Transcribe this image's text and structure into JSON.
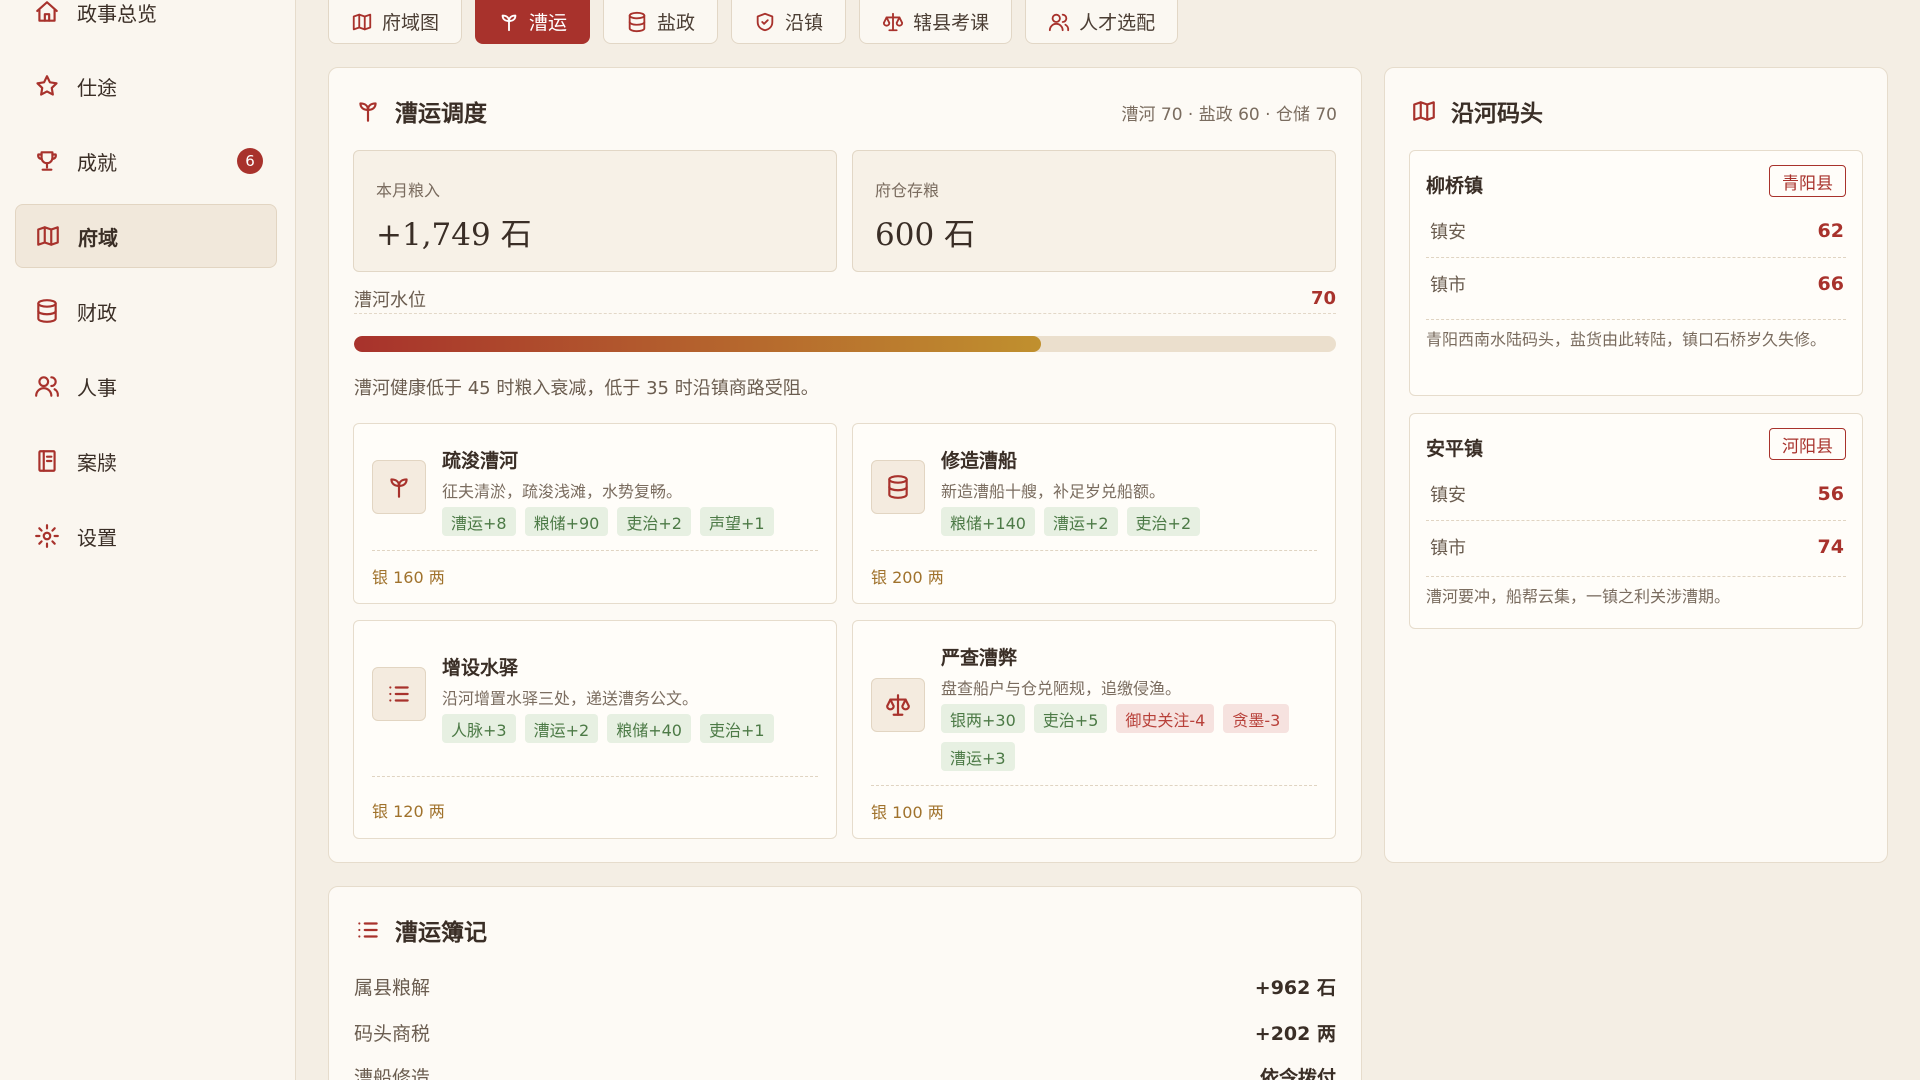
{
  "sidebar": {
    "items": [
      {
        "label": "政事总览",
        "icon": "home-icon"
      },
      {
        "label": "仕途",
        "icon": "star-icon"
      },
      {
        "label": "成就",
        "icon": "trophy-icon",
        "badge": "6"
      },
      {
        "label": "府域",
        "icon": "map-icon",
        "active": true
      },
      {
        "label": "财政",
        "icon": "database-icon"
      },
      {
        "label": "人事",
        "icon": "users-icon"
      },
      {
        "label": "案牍",
        "icon": "book-icon"
      },
      {
        "label": "设置",
        "icon": "gear-icon"
      }
    ]
  },
  "tabs": [
    {
      "label": "府域图",
      "icon": "map-icon"
    },
    {
      "label": "漕运",
      "icon": "sprout-icon",
      "active": true
    },
    {
      "label": "盐政",
      "icon": "database-icon"
    },
    {
      "label": "沿镇",
      "icon": "shield-icon"
    },
    {
      "label": "辖县考课",
      "icon": "scale-icon"
    },
    {
      "label": "人才选配",
      "icon": "users-icon"
    }
  ],
  "transport": {
    "title": "漕运调度",
    "meta": "漕河 70 · 盐政 60 · 仓储 70",
    "stats": [
      {
        "label": "本月粮入",
        "value": "+1,749 石"
      },
      {
        "label": "府仓存粮",
        "value": "600 石"
      }
    ],
    "water": {
      "label": "漕河水位",
      "value": "70",
      "level": 70
    },
    "note": "漕河健康低于 45 时粮入衰减，低于 35 时沿镇商路受阻。",
    "actions": [
      {
        "title": "疏浚漕河",
        "desc": "征夫清淤，疏浚浅滩，水势复畅。",
        "icon": "sprout-icon",
        "chips": [
          {
            "t": "漕运+8"
          },
          {
            "t": "粮储+90"
          },
          {
            "t": "吏治+2"
          },
          {
            "t": "声望+1"
          }
        ],
        "cost": "银 160 两"
      },
      {
        "title": "修造漕船",
        "desc": "新造漕船十艘，补足岁兑船额。",
        "icon": "database-icon",
        "chips": [
          {
            "t": "粮储+140"
          },
          {
            "t": "漕运+2"
          },
          {
            "t": "吏治+2"
          }
        ],
        "cost": "银 200 两"
      },
      {
        "title": "增设水驿",
        "desc": "沿河增置水驿三处，递送漕务公文。",
        "icon": "list-icon",
        "chips": [
          {
            "t": "人脉+3"
          },
          {
            "t": "漕运+2"
          },
          {
            "t": "粮储+40"
          },
          {
            "t": "吏治+1"
          }
        ],
        "cost": "银 120 两"
      },
      {
        "title": "严查漕弊",
        "desc": "盘查船户与仓兑陋规，追缴侵渔。",
        "icon": "scale-icon",
        "chips": [
          {
            "t": "银两+30"
          },
          {
            "t": "吏治+5"
          },
          {
            "t": "御史关注-4",
            "neg": true
          },
          {
            "t": "贪墨-3",
            "neg": true
          },
          {
            "t": "漕运+3"
          }
        ],
        "cost": "银 100 两"
      }
    ]
  },
  "wharf": {
    "title": "沿河码头",
    "towns": [
      {
        "name": "柳桥镇",
        "county": "青阳县",
        "rows": [
          {
            "k": "镇安",
            "v": "62"
          },
          {
            "k": "镇市",
            "v": "66"
          }
        ],
        "note": "青阳西南水陆码头，盐货由此转陆，镇口石桥岁久失修。"
      },
      {
        "name": "安平镇",
        "county": "河阳县",
        "rows": [
          {
            "k": "镇安",
            "v": "56"
          },
          {
            "k": "镇市",
            "v": "74"
          }
        ],
        "note": "漕河要冲，船帮云集，一镇之利关涉漕期。"
      }
    ]
  },
  "log": {
    "title": "漕运簿记",
    "rows": [
      {
        "k": "属县粮解",
        "v": "+962 石"
      },
      {
        "k": "码头商税",
        "v": "+202 两"
      },
      {
        "k": "漕船修造",
        "v": "依令拨付"
      }
    ]
  }
}
